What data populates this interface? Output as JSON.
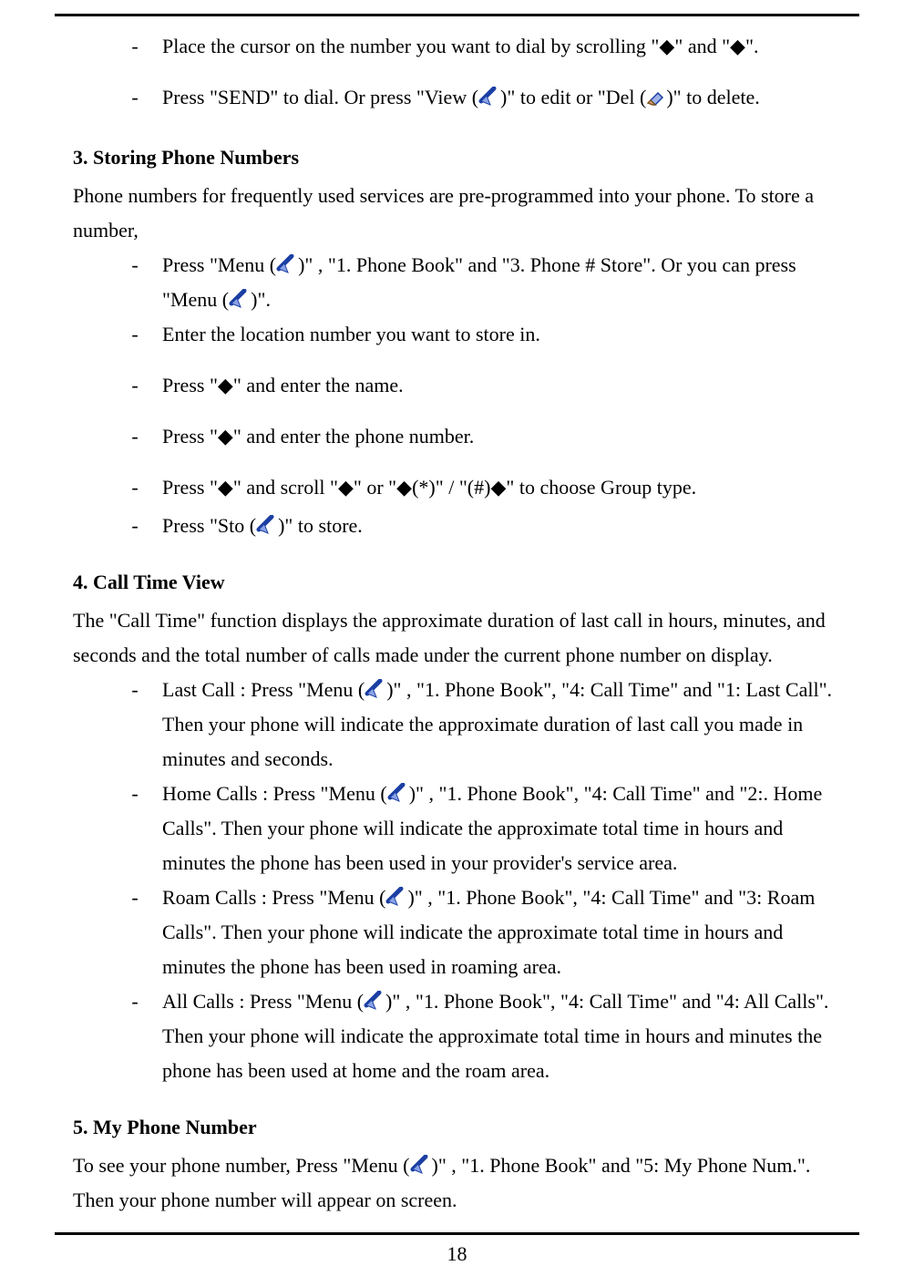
{
  "page_number": "18",
  "block1": {
    "bullets": [
      "Place the cursor on the number you want to dial by scrolling \"◆\" and \"◆\".",
      [
        "Press \"SEND\" to dial. Or press \"View (",
        "SOFTKEY",
        ")\" to edit or \"Del (",
        "ERASER",
        ")\" to delete."
      ]
    ]
  },
  "block2": {
    "heading": "3. Storing Phone Numbers",
    "intro": "Phone numbers for frequently used services are pre-programmed into your phone. To store a number,",
    "bullets": [
      [
        "Press \"Menu (",
        "SOFTKEY",
        ")\" ,  \"1. Phone Book\" and \"3. Phone # Store\". Or you can press \"Menu (",
        "SOFTKEY",
        ")\"."
      ],
      "Enter the location number you want to store in.",
      "Press \"◆\" and enter the name.",
      "Press \"◆\" and enter the phone number.",
      "Press \"◆\" and scroll \"◆\" or \"◆(*)\" / \"(#)◆\" to choose Group type.",
      [
        "Press \"Sto (",
        "SOFTKEY",
        ")\" to store."
      ]
    ]
  },
  "block3": {
    "heading": "4. Call Time View",
    "intro": "The \"Call Time\" function displays the approximate duration of last call in hours, minutes, and seconds and the total number of calls made under the current phone number on display.",
    "bullets": [
      [
        "Last Call : Press \"Menu (",
        "SOFTKEY",
        ")\" ,  \"1. Phone Book\", \"4: Call Time\" and \"1: Last Call\". Then your phone will indicate the approximate duration of last call you made in minutes and seconds."
      ],
      [
        "Home Calls : Press \"Menu (",
        "SOFTKEY",
        ")\" ,  \"1. Phone Book\", \"4: Call Time\" and \"2:. Home Calls\". Then your phone will indicate the approximate total time in hours and minutes the phone has been used in your provider's service area."
      ],
      [
        "Roam Calls : Press \"Menu (",
        "SOFTKEY",
        ")\" ,  \"1. Phone Book\", \"4: Call Time\" and \"3: Roam Calls\". Then your phone will indicate the approximate total time in hours and minutes the phone has been used in roaming area."
      ],
      [
        "All Calls : Press \"Menu (",
        "SOFTKEY",
        ")\" ,  \"1. Phone Book\", \"4: Call Time\" and \"4: All Calls\". Then your phone will indicate the approximate total time in hours and minutes the phone has been used at home and the roam area."
      ]
    ]
  },
  "block4": {
    "heading": "5. My Phone Number",
    "intro": [
      "To see your phone number, Press \"Menu (",
      "SOFTKEY",
      ")\" ,  \"1. Phone Book\" and \"5: My Phone Num.\". Then your phone number will appear on screen."
    ]
  }
}
